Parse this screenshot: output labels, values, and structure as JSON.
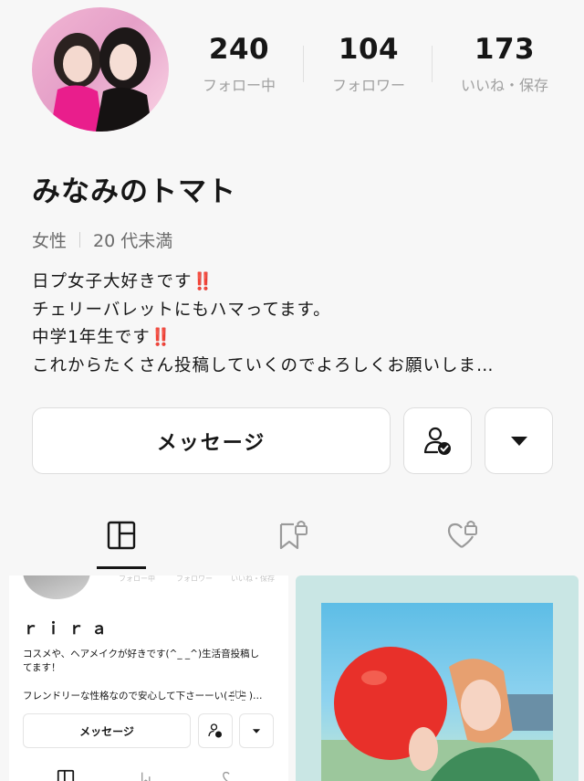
{
  "profile": {
    "name": "みなみのトマト",
    "gender": "女性",
    "age": "20 代未満",
    "bio": {
      "line1": "日プ女子大好きです",
      "line2": "チェリーバレットにもハマってます。",
      "line3": "中学1年生です",
      "line4": "これからたくさん投稿していくのでよろしくお願いしま…",
      "emoji": "‼️"
    }
  },
  "stats": {
    "following": {
      "value": "240",
      "label": "フォロー中"
    },
    "followers": {
      "value": "104",
      "label": "フォロワー"
    },
    "likes": {
      "value": "173",
      "label": "いいね・保存"
    }
  },
  "actions": {
    "message": "メッセージ"
  },
  "tabs": [
    {
      "icon": "grid-icon",
      "active": true
    },
    {
      "icon": "bookmark-lock-icon",
      "active": false
    },
    {
      "icon": "heart-lock-icon",
      "active": false
    }
  ],
  "posts": {
    "left": {
      "stat_labels": [
        "フォロー中",
        "フォロワー",
        "いいね・保存"
      ],
      "name": "ｒｉｒａ",
      "bio_line1": "コスメや、ヘアメイクが好きです(^_ _^)生活音投稿し",
      "bio_line2": "てます！",
      "bio_line3": "フレンドリーな性格なので安心して下さーーい( ᵔ̴̶̤᷄ꇴᵔ̴̶̤᷅ )…",
      "message": "メッセージ"
    }
  },
  "colors": {
    "accent_red": "#e0282d",
    "background": "#f7f7f7",
    "text": "#161616",
    "muted": "#a0a0a0"
  }
}
